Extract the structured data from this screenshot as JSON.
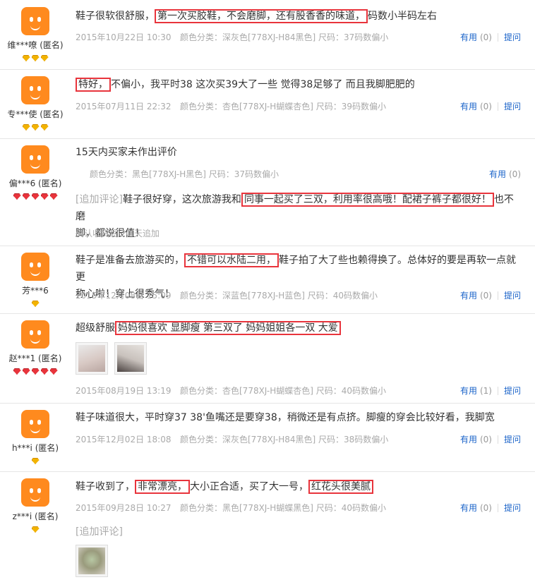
{
  "helpful_label": "有用",
  "ask_label": "提问",
  "reviews": [
    {
      "user": "维***嘹 (匿名)",
      "badge": "gold",
      "badge_count": 3,
      "text_before": "鞋子很软很舒服，",
      "text_hl": "第一次买胶鞋，不会磨脚，还有股香香的味道，",
      "text_after": "码数小半码左右",
      "date": "2015年10月22日 10:30",
      "color": "颜色分类：深灰色[778XJ-H84黑色]  尺码：37码数偏小",
      "helpful": "(0)"
    },
    {
      "user": "专***使 (匿名)",
      "badge": "gold",
      "badge_count": 3,
      "text_hl": "特好，",
      "text_after": "不偏小，我平时38 这次买39大了一些 觉得38足够了 而且我脚肥肥的",
      "date": "2015年07月11日 22:32",
      "color": "颜色分类：杏色[778XJ-H蝴蝶杏色]  尺码：39码数偏小",
      "helpful": "(0)"
    },
    {
      "user": "偏***6 (匿名)",
      "badge": "red",
      "badge_count": 5,
      "text": "15天内买家未作出评价",
      "color": "颜色分类：黑色[778XJ-H黑色]  尺码：37码数偏小",
      "helpful": "(0)",
      "append_label": "[追加评论]",
      "append_before": "鞋子很好穿，这次旅游我和",
      "append_hl": "同事一起买了三双，利用率很高哦！配裙子裤子都很好！",
      "append_after1": "也不磨",
      "append_after2": "脚，都说很值！",
      "append_note": "确认收货后 20 天追加"
    },
    {
      "user": "芳***6",
      "badge": "gold",
      "badge_count": 1,
      "text_before": "鞋子是准备去旅游买的，",
      "text_hl": "不错可以水陆二用，",
      "text_after": "鞋子拍了大了些也赖得换了。总体好的要是再软一点就更",
      "text_line2": "称心啦！穿上很秀气！",
      "date": "2015年12月08日 15:09",
      "color": "颜色分类：深蓝色[778XJ-H蓝色]  尺码：40码数偏小",
      "helpful": "(0)"
    },
    {
      "user": "赵***1 (匿名)",
      "badge": "red",
      "badge_count": 5,
      "text_before": "超级舒服",
      "text_hl": "妈妈很喜欢 显脚瘦 第三双了 妈妈姐姐各一双 大爱",
      "date": "2015年08月19日 13:19",
      "color": "颜色分类：杏色[778XJ-H蝴蝶杏色]  尺码：40码数偏小",
      "helpful": "(1)"
    },
    {
      "user": "h***i (匿名)",
      "badge": "gold",
      "badge_count": 1,
      "text": "鞋子味道很大，平时穿37 38'鱼嘴还是要穿38，稍微还是有点挤。脚瘦的穿会比较好看，我脚宽",
      "date": "2015年12月02日 18:08",
      "color": "颜色分类：深灰色[778XJ-H84黑色]  尺码：38码数偏小",
      "helpful": "(0)"
    },
    {
      "user": "z***i (匿名)",
      "badge": "gold",
      "badge_count": 1,
      "text_before": "鞋子收到了，",
      "text_hl": "非常漂亮，",
      "text_mid": "大小正合适，买了大一号，",
      "text_hl2": "红花头很美腻",
      "date": "2015年09月28日 10:27",
      "color": "颜色分类：黑色[778XJ-H蝴蝶黑色]  尺码：40码数偏小",
      "helpful": "(0)",
      "append_label": "[追加评论]"
    }
  ]
}
